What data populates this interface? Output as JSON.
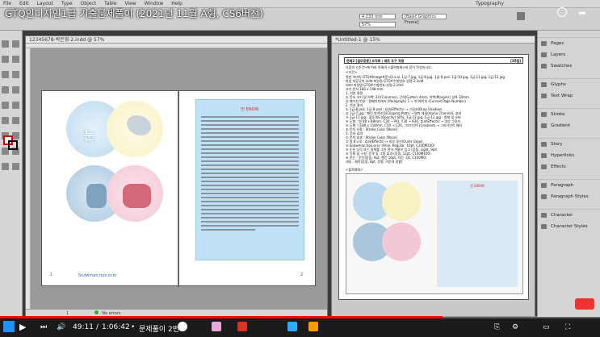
{
  "video": {
    "title": "GTQ인디자인1급 기출문제풀이 (2021년 11월 A형, CS6버전)",
    "time_current": "49:11",
    "time_total": "1:06:42",
    "chapter": "문제풀이 2번",
    "progress": 0.737
  },
  "app": {
    "menu": [
      "File",
      "Edit",
      "Layout",
      "Type",
      "Object",
      "Table",
      "View",
      "Window",
      "Help"
    ],
    "workspace": "Typography",
    "control_zoom": "57%",
    "paragraph_style": "[Basic Paragraph]",
    "frame_style": "[Basic Graphics Frame]"
  },
  "doc1": {
    "tab": "12345678-박은영-2.indd @ 57%",
    "title_text": "한 ENOW",
    "url_text": "Snowman.hpv.or.kr",
    "page_num_left": "1",
    "page_num_right": "2",
    "status_page": "1",
    "status_errors": "No errors"
  },
  "doc2": {
    "tab": "*Untitled-1 @ 15%",
    "header_left": "문제2 [실무응용] 조각화 / 레트 도구 작용",
    "header_right": "[35점]",
    "note": "다음의 <조건>에 따라 아래의 <출력형태>와 같이 작성하시오.",
    "cond_label": "<조건>",
    "lines": [
      "원본 이미지   GTQ#Image#문서2-s.ai, 1급-7.jpg, 1급-8.jpg, 1급-9.psd, 1급-10.jpg, 1급-11.jpg, 1급-12.jpg",
      "파일 저장규칙   indd   파일명   GTQ#수험번호-성명-2.indd",
      "idml   파일명   GTQ#수험번호-성명-2.idml",
      "크기   문서   180 x 148 mm",
      "1. 기본 설정",
      "① 문서 크기 및 여백: 2단(Columns), 간격(Gutter) 4mm, 여백(Margins) 상하 30mm",
      "② 페이지 번호 : 원페이지에서 (Paragraph) 1 ~ 번 페이지 (Current Page Number)",
      "2. 작성 결과",
      "① 1급-8.psd, 1급-9.psd : 효과(Effects) → 그림자(Drop Shadow)",
      "② 1급-7.jpg : 패턴 원색조정(Clipping Path) → 알파 채널(Alpha Channel), 효과",
      "③ 1급-11.jpg : 불투명도(Opacity) 60%, 1급-11.jpg, 1급-12.jpg : 원형 및 오버",
      "④ 도형 : 원 88 x 88mm, C30 ~ M3, Y30 ~ K30, 효과(Effects) → 내부 그림자",
      "⑤ 도형 : (180 x 118mm, C50 → C20, 그라디언트(Gradient) → 그라디언트 패더",
      "⑥ 문자 사용 : Stroke Color [None]",
      "3. 문자 효과",
      "① 문자 효과 : Stroke Color [None]",
      "② 원 8 x 8 : 효과(Effects) → 외부 광선(Outer Glow)",
      "③ Snowman.hpv.or.kr (Arial, Regular, 10pt, C100M100)",
      "④ 눈은 다각 또는 일체를 그린 전이 겨울이 입고 (돋움, Light, 9pt)",
      "⑤ 기획 및 구성: 윤곽 및 그림 효과 (돋움, 12pt, C100M100)",
      "⑥ 문단 : 문단(돋움, 9pt, 행간 16pt, 자간 -10, C100M0)",
      "세부 : 제목(돋움, 8pt, 정렬: 가운데 정렬)"
    ],
    "output_label": "<출력형태>",
    "out_title": "한 ENOW"
  },
  "panels": [
    {
      "label": "Pages",
      "icon": "pages-icon"
    },
    {
      "label": "Layers",
      "icon": "layers-icon"
    },
    {
      "label": "Swatches",
      "icon": "swatches-icon"
    },
    {
      "label": "Glyphs",
      "icon": "glyphs-icon"
    },
    {
      "label": "Text Wrap",
      "icon": "text-wrap-icon"
    },
    {
      "label": "Stroke",
      "icon": "stroke-icon"
    },
    {
      "label": "Gradient",
      "icon": "gradient-icon"
    },
    {
      "label": "Story",
      "icon": "story-icon"
    },
    {
      "label": "Hyperlinks",
      "icon": "hyperlinks-icon"
    },
    {
      "label": "Effects",
      "icon": "effects-icon"
    },
    {
      "label": "Paragraph",
      "icon": "paragraph-icon"
    },
    {
      "label": "Paragraph Styles",
      "icon": "paragraph-styles-icon"
    },
    {
      "label": "Character",
      "icon": "character-icon"
    },
    {
      "label": "Character Styles",
      "icon": "character-styles-icon"
    }
  ],
  "colors": {
    "accent_red": "#ff0000",
    "circle_blue": "#bcd9ee",
    "circle_yellow": "#f7f1c4",
    "circle_pink": "#f3c7d6",
    "text_frame": "#bfe0f5"
  }
}
